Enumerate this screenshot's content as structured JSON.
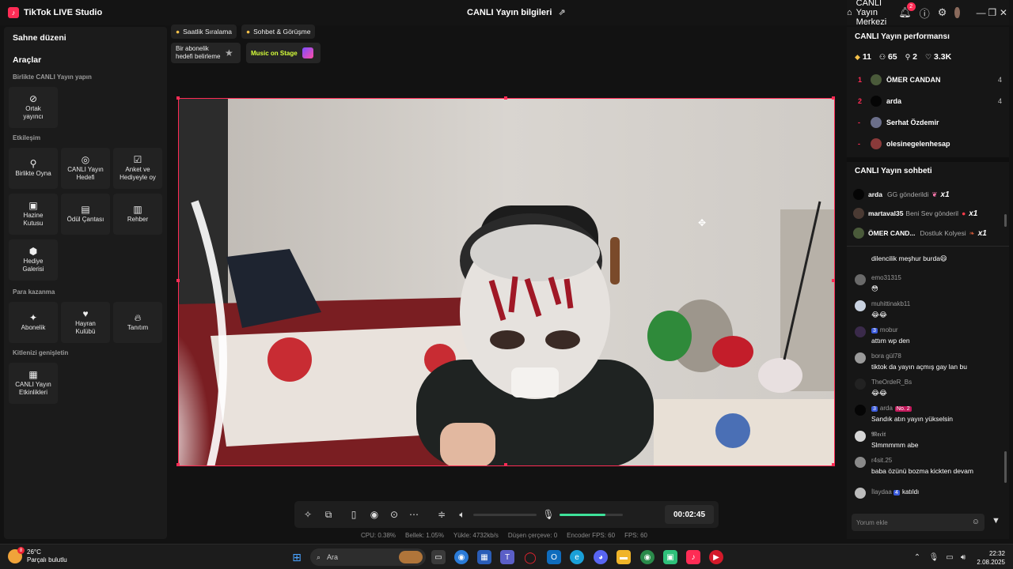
{
  "titlebar": {
    "app_name": "TikTok LIVE Studio",
    "center_title": "CANLI Yayın bilgileri",
    "live_center": "CANLI Yayın Merkezi",
    "notif_count": "2"
  },
  "left": {
    "scene_title": "Sahne düzeni",
    "tools_title": "Araçlar",
    "sections": {
      "together": "Birlikte CANLI Yayın yapın",
      "interaction": "Etkileşim",
      "monetize": "Para kazanma",
      "expand": "Kitlenizi genişletin"
    },
    "tools": {
      "cohost": "Ortak yayıncı",
      "play_together": "Birlikte Oyna",
      "live_goal": "CANLI Yayın Hedefi",
      "poll": "Anket ve Hediyeyle oy",
      "treasure": "Hazine Kutusu",
      "reward_bag": "Ödül Çantası",
      "guide": "Rehber",
      "gift_gallery": "Hediye Galerisi",
      "subscription": "Abonelik",
      "fan_club": "Hayran Kulübü",
      "promote": "Tanıtım",
      "live_events": "CANLI Yayın Etkinlikleri"
    }
  },
  "top_chips": {
    "hourly_rank": "Saatlik Sıralama",
    "chat_meet": "Sohbet & Görüşme",
    "sub_goal": "Bir abonelik hedefi belirleme",
    "music_stage": "Music on Stage"
  },
  "controls": {
    "timer": "00:02:45",
    "mic_level": 0.72
  },
  "stats": {
    "cpu": "CPU:  0.38%",
    "memory": "Bellek:  1.05%",
    "upload": "Yükle:  4732kb/s",
    "dropped": "Düşen çerçeve:  0",
    "encoder_fps": "Encoder FPS:  60",
    "fps": "FPS:  60"
  },
  "right": {
    "perf_title": "CANLI Yayın performansı",
    "perf": {
      "diamonds": "11",
      "viewers": "65",
      "followers": "2",
      "likes": "3.3K"
    },
    "ranking": [
      {
        "rank": "1",
        "name": "ÖMER CANDAN",
        "count": "4"
      },
      {
        "rank": "2",
        "name": "arda",
        "count": "4"
      },
      {
        "rank": "-",
        "name": "Serhat Özdemir",
        "count": ""
      },
      {
        "rank": "-",
        "name": "olesinegelenhesap",
        "count": ""
      }
    ],
    "chat_title": "CANLI Yayın sohbeti",
    "gifts": [
      {
        "name": "arda",
        "text": "GG gönderildi",
        "mult": "x1"
      },
      {
        "name": "martaval35",
        "text": "Beni Sev gönderil",
        "mult": "x1"
      },
      {
        "name": "ÖMER CAND...",
        "text": "Dostluk Kolyesi",
        "mult": "x1"
      }
    ],
    "messages": [
      {
        "name": "",
        "text": "dilencilik meşhur burda😄"
      },
      {
        "name": "emo31315",
        "text": "😳"
      },
      {
        "name": "muhittinakb11",
        "text": "😂😂"
      },
      {
        "name": "mobur",
        "level": "3",
        "text": "attım wp den"
      },
      {
        "name": "bora gül78",
        "text": "tiktok da yayın açmış gay lan bu"
      },
      {
        "name": "TheOrdeR_Bs",
        "text": "😂😂"
      },
      {
        "name": "arda",
        "level": "3",
        "badge": "No. 2",
        "text": "Sandık atın yayın yükselsin"
      },
      {
        "name": "𝕸𝖊𝖈𝖎𝖙",
        "text": "Slmmmmm abe"
      },
      {
        "name": "r4sit.25",
        "text": "baba özünü bozma kickten devam"
      },
      {
        "name": "İlaydaa",
        "level": "4",
        "text": "katıldı"
      }
    ],
    "comment_placeholder": "Yorum ekle"
  },
  "taskbar": {
    "temp": "26°C",
    "weather": "Parçalı bulutlu",
    "search": "Ara",
    "time": "22:32",
    "date": "2.08.2025",
    "weather_badge": "8"
  }
}
